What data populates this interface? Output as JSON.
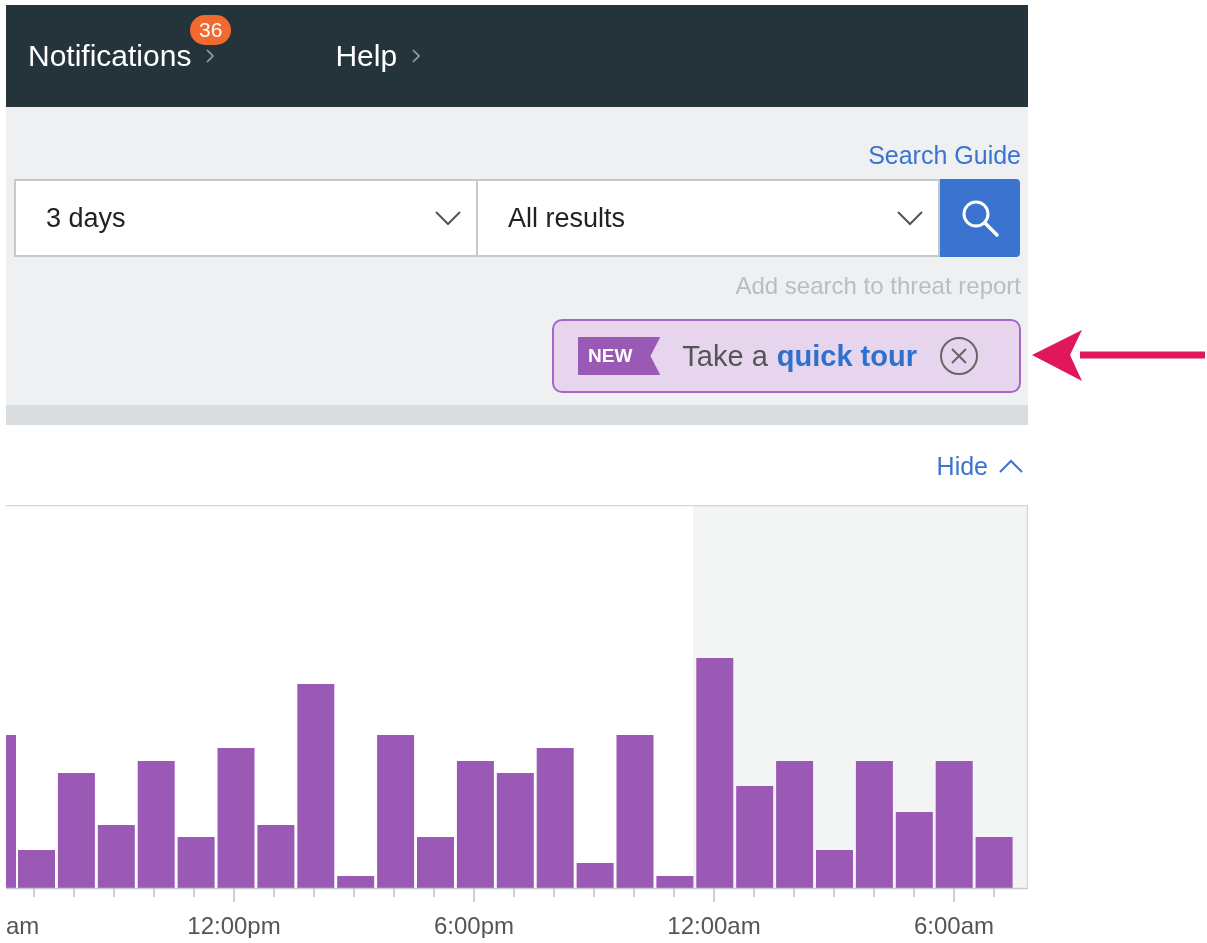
{
  "nav": [
    {
      "label": "Notifications",
      "badge": "36"
    },
    {
      "label": "Help"
    }
  ],
  "search_guide": "Search Guide",
  "filters": [
    {
      "value": "3 days"
    },
    {
      "value": "All results"
    }
  ],
  "add_to_report": {
    "label": "Add search to threat report",
    "disabled": true
  },
  "tour": {
    "tag": "NEW",
    "text": "Take a",
    "link": "quick tour"
  },
  "hide": "Hide",
  "chart": {
    "axis_labels": [
      "am",
      "12:00pm",
      "6:00pm",
      "12:00am",
      "6:00am"
    ]
  }
}
